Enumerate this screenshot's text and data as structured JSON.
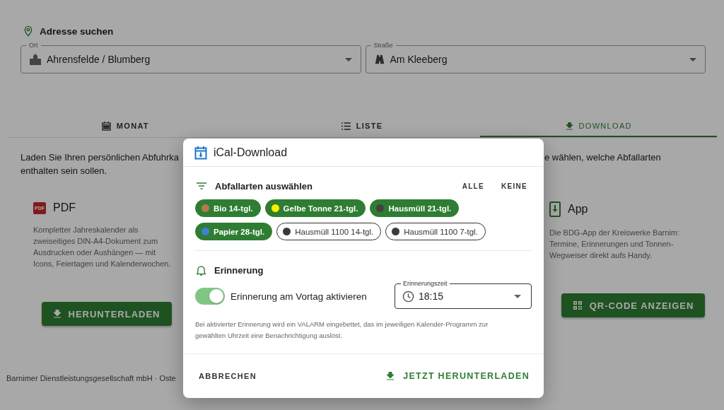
{
  "address_search": {
    "title": "Adresse suchen",
    "fields": [
      {
        "kind": "city",
        "label": "Ort",
        "value": "Ahrensfelde / Blumberg"
      },
      {
        "kind": "street",
        "label": "Straße",
        "value": "Am Kleeberg"
      }
    ]
  },
  "tabs": [
    {
      "kind": "calendar",
      "label": "MONAT",
      "selected": false
    },
    {
      "kind": "list",
      "label": "LISTE",
      "selected": false
    },
    {
      "kind": "download",
      "label": "DOWNLOAD",
      "selected": true
    }
  ],
  "intro": {
    "line_1_left": "Laden Sie Ihren persönlichen Abfuhrka",
    "line_1_right": "e wählen, welche Abfallarten",
    "line_2": "enthalten sein sollen."
  },
  "cards": [
    {
      "kind": "pdf",
      "badge": "PDF",
      "title": "PDF",
      "text": "Kompletter Jahreskalender als zweiseitiges DIN-A4-Dokument zum Ausdrucken oder Aushängen — mit Icons, Feiertagen und Kalenderwochen.",
      "button": "HERUNTERLADEN"
    },
    {
      "kind": "app",
      "title": "App",
      "text": "Die BDG-App der Kreiswerke Barnim: Termine, Erinnerungen und Tonnen-Wegweiser direkt aufs Handy.",
      "button": "QR-CODE ANZEIGEN"
    }
  ],
  "footer": "Barnimer Dienstleistungsgesellschaft mbH · Oste",
  "dialog": {
    "title": "iCal-Download",
    "types_title": "Abfallarten auswählen",
    "select_all": "ALLE",
    "select_none": "KEINE",
    "types": [
      {
        "label": "Bio 14-tgl.",
        "color": "#b5794f",
        "selected": true
      },
      {
        "label": "Gelbe Tonne 21-tgl.",
        "color": "#ffee00",
        "selected": true
      },
      {
        "label": "Hausmüll 21-tgl.",
        "color": "#424242",
        "selected": true
      },
      {
        "label": "Papier 28-tgl.",
        "color": "#3f7fd6",
        "selected": true
      },
      {
        "label": "Hausmüll 1100 14-tgl.",
        "color": "#3a3a3a",
        "selected": false
      },
      {
        "label": "Hausmüll 1100 7-tgl.",
        "color": "#3b3b3b",
        "selected": false
      }
    ],
    "reminder_title": "Erinnerung",
    "reminder_switch": {
      "label": "Erinnerung am Vortag aktivieren",
      "on": true
    },
    "reminder_time": {
      "label": "Erinnerungszeit",
      "value": "18:15"
    },
    "hint": "Bei aktivierter Erinnerung wird ein VALARM eingebettet, das im jeweiligen Kalender-Programm zur gewählten Uhrzeit eine Benachrichtigung auslöst.",
    "cancel": "ABBRECHEN",
    "confirm": "JETZT HERUNTERLADEN"
  }
}
